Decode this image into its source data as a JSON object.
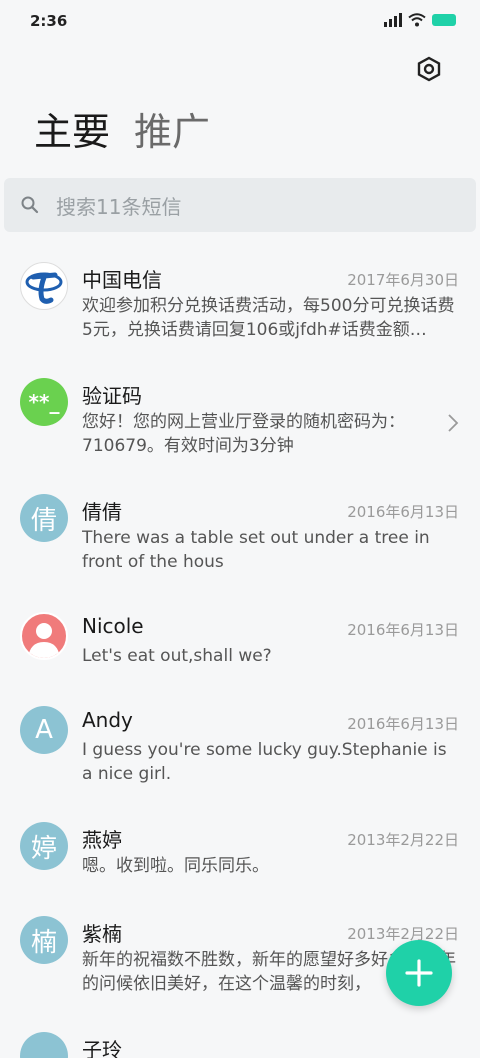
{
  "status": {
    "time": "2:36"
  },
  "header": {
    "tabs": [
      {
        "label": "主要",
        "active": true
      },
      {
        "label": "推广",
        "active": false
      }
    ]
  },
  "search": {
    "placeholder": "搜索11条短信"
  },
  "messages": [
    {
      "name": "中国电信",
      "date": "2017年6月30日",
      "preview": "欢迎参加积分兑换话费活动，每500分可兑换话费5元，兑换话费请回复106或jfdh#话费金额…",
      "avatar": "telecom-logo-icon",
      "avatar_color": "#ffffff"
    },
    {
      "name": "验证码",
      "date": "",
      "preview": "您好！您的网上营业厅登录的随机密码为：710679。有效时间为3分钟",
      "avatar_text": "**_",
      "avatar_color": "#6ad14f"
    },
    {
      "name": "倩倩",
      "date": "2016年6月13日",
      "preview": "There was a table set out under a tree in front of the hous",
      "avatar_text": "倩",
      "avatar_color": "#8cc3d3"
    },
    {
      "name": "Nicole",
      "date": "2016年6月13日",
      "preview": "Let's eat out,shall we?",
      "avatar": "person-icon",
      "avatar_color": "#f07b7b"
    },
    {
      "name": "Andy",
      "date": "2016年6月13日",
      "preview": "I guess you're some lucky guy.Stephanie is a nice girl.",
      "avatar_text": "A",
      "avatar_color": "#8cc3d3"
    },
    {
      "name": "燕婷",
      "date": "2013年2月22日",
      "preview": "嗯。收到啦。同乐同乐。",
      "avatar_text": "婷",
      "avatar_color": "#8cc3d3"
    },
    {
      "name": "紫楠",
      "date": "2013年2月22日",
      "preview": "新年的祝福数不胜数，新年的愿望好多好多，新年的问候依旧美好，在这个温馨的时刻，",
      "avatar_text": "楠",
      "avatar_color": "#8cc3d3"
    },
    {
      "name": "子玲",
      "date": "",
      "preview": "",
      "avatar_text": "",
      "avatar_color": "#8cc3d3"
    }
  ],
  "colors": {
    "accent": "#1fd1a8",
    "avatar_default": "#8cc3d3"
  }
}
